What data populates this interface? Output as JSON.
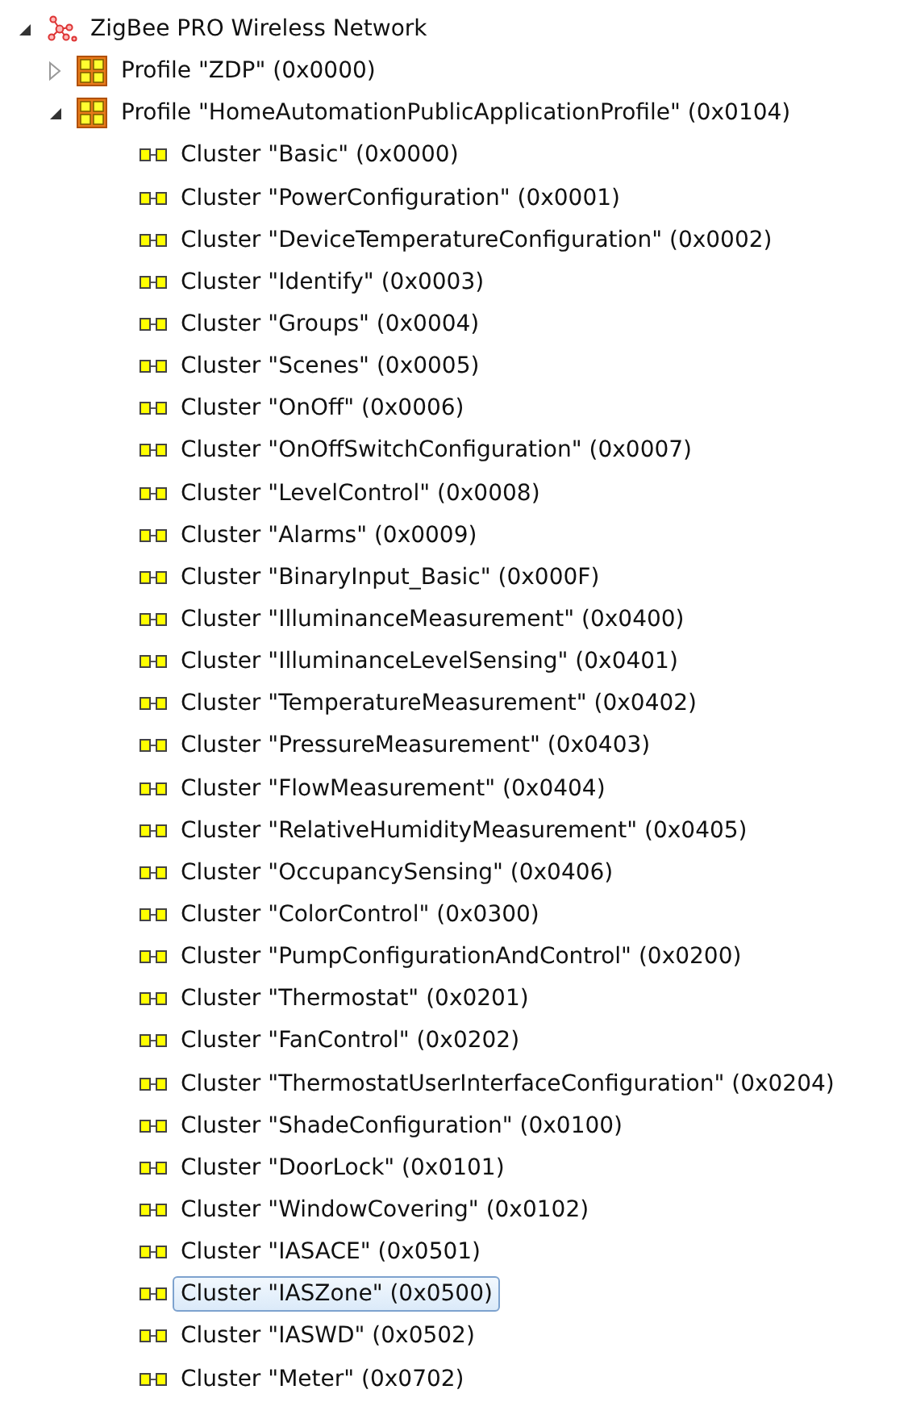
{
  "tree": [
    {
      "kind": "network",
      "label": "ZigBee PRO Wireless Network",
      "expanded": true,
      "children": [
        {
          "kind": "profile",
          "label": "Profile \"ZDP\" (0x0000)",
          "expanded": false
        },
        {
          "kind": "profile",
          "label": "Profile \"HomeAutomationPublicApplicationProfile\" (0x0104)",
          "expanded": true,
          "children": [
            {
              "kind": "cluster",
              "label": "Cluster \"Basic\" (0x0000)",
              "selected": false
            },
            {
              "kind": "cluster",
              "label": "Cluster \"PowerConfiguration\" (0x0001)",
              "selected": false
            },
            {
              "kind": "cluster",
              "label": "Cluster \"DeviceTemperatureConfiguration\" (0x0002)",
              "selected": false
            },
            {
              "kind": "cluster",
              "label": "Cluster \"Identify\" (0x0003)",
              "selected": false
            },
            {
              "kind": "cluster",
              "label": "Cluster \"Groups\" (0x0004)",
              "selected": false
            },
            {
              "kind": "cluster",
              "label": "Cluster \"Scenes\" (0x0005)",
              "selected": false
            },
            {
              "kind": "cluster",
              "label": "Cluster \"OnOff\" (0x0006)",
              "selected": false
            },
            {
              "kind": "cluster",
              "label": "Cluster \"OnOffSwitchConfiguration\" (0x0007)",
              "selected": false
            },
            {
              "kind": "cluster",
              "label": "Cluster \"LevelControl\" (0x0008)",
              "selected": false
            },
            {
              "kind": "cluster",
              "label": "Cluster \"Alarms\" (0x0009)",
              "selected": false
            },
            {
              "kind": "cluster",
              "label": "Cluster \"BinaryInput_Basic\" (0x000F)",
              "selected": false
            },
            {
              "kind": "cluster",
              "label": "Cluster \"IlluminanceMeasurement\" (0x0400)",
              "selected": false
            },
            {
              "kind": "cluster",
              "label": "Cluster \"IlluminanceLevelSensing\" (0x0401)",
              "selected": false
            },
            {
              "kind": "cluster",
              "label": "Cluster \"TemperatureMeasurement\" (0x0402)",
              "selected": false
            },
            {
              "kind": "cluster",
              "label": "Cluster \"PressureMeasurement\" (0x0403)",
              "selected": false
            },
            {
              "kind": "cluster",
              "label": "Cluster \"FlowMeasurement\" (0x0404)",
              "selected": false
            },
            {
              "kind": "cluster",
              "label": "Cluster \"RelativeHumidityMeasurement\" (0x0405)",
              "selected": false
            },
            {
              "kind": "cluster",
              "label": "Cluster \"OccupancySensing\" (0x0406)",
              "selected": false
            },
            {
              "kind": "cluster",
              "label": "Cluster \"ColorControl\" (0x0300)",
              "selected": false
            },
            {
              "kind": "cluster",
              "label": "Cluster \"PumpConfigurationAndControl\" (0x0200)",
              "selected": false
            },
            {
              "kind": "cluster",
              "label": "Cluster \"Thermostat\" (0x0201)",
              "selected": false
            },
            {
              "kind": "cluster",
              "label": "Cluster \"FanControl\" (0x0202)",
              "selected": false
            },
            {
              "kind": "cluster",
              "label": "Cluster \"ThermostatUserInterfaceConfiguration\" (0x0204)",
              "selected": false
            },
            {
              "kind": "cluster",
              "label": "Cluster \"ShadeConfiguration\" (0x0100)",
              "selected": false
            },
            {
              "kind": "cluster",
              "label": "Cluster \"DoorLock\" (0x0101)",
              "selected": false
            },
            {
              "kind": "cluster",
              "label": "Cluster \"WindowCovering\" (0x0102)",
              "selected": false
            },
            {
              "kind": "cluster",
              "label": "Cluster \"IASACE\" (0x0501)",
              "selected": false
            },
            {
              "kind": "cluster",
              "label": "Cluster \"IASZone\" (0x0500)",
              "selected": true
            },
            {
              "kind": "cluster",
              "label": "Cluster \"IASWD\" (0x0502)",
              "selected": false
            },
            {
              "kind": "cluster",
              "label": "Cluster \"Meter\" (0x0702)",
              "selected": false
            }
          ]
        }
      ]
    }
  ]
}
